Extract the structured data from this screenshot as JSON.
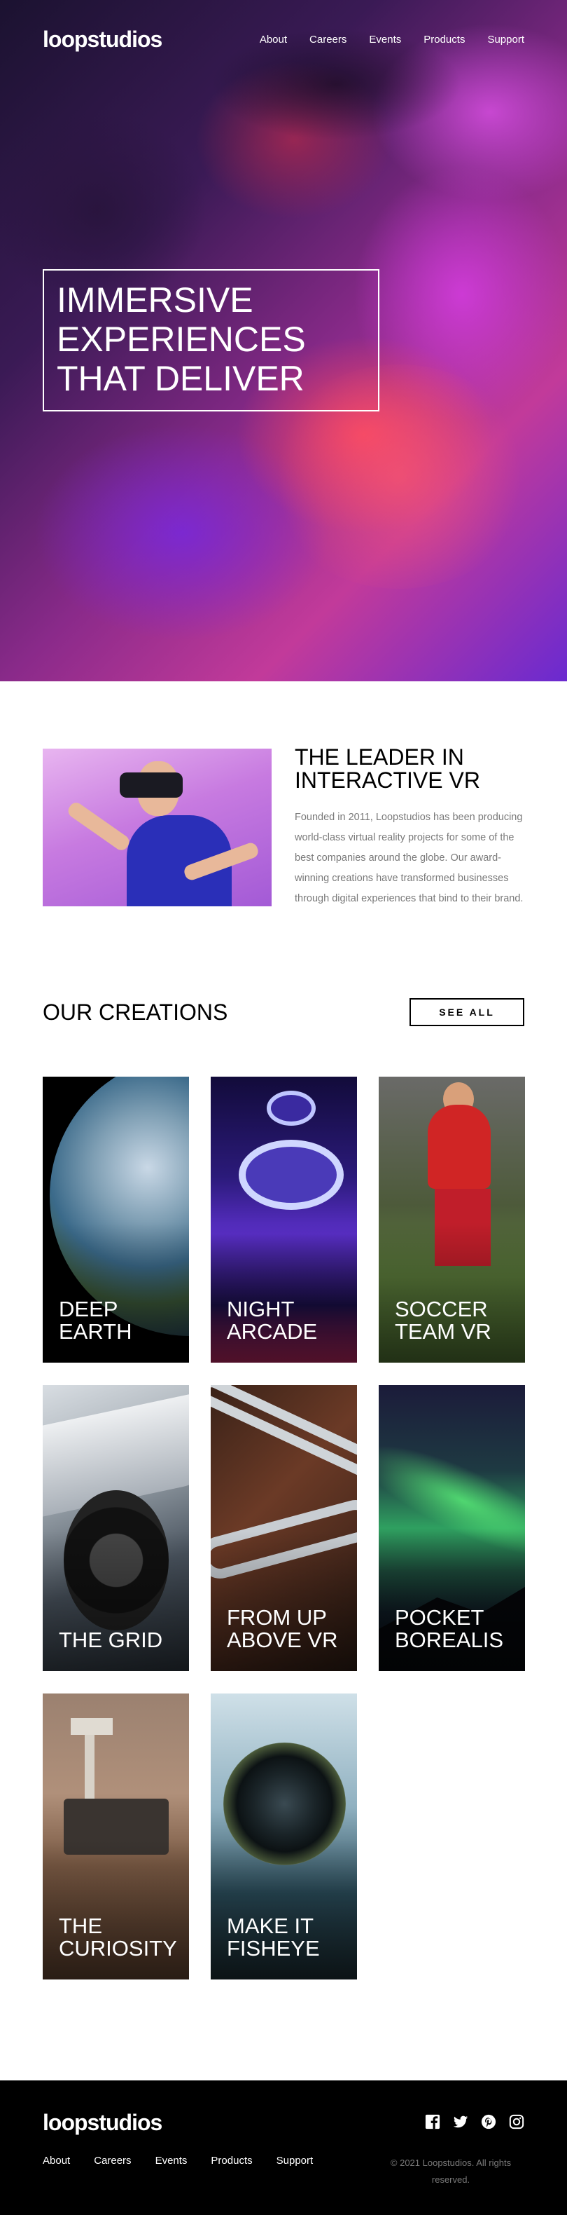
{
  "nav": {
    "logo": "loopstudios",
    "links": [
      "About",
      "Careers",
      "Events",
      "Products",
      "Support"
    ]
  },
  "hero": {
    "title": "Immersive experiences that deliver"
  },
  "leader": {
    "title": "The leader in interactive VR",
    "body": "Founded in 2011, Loopstudios has been producing world-class virtual reality projects for some of the best companies around the globe. Our award-winning creations have transformed businesses through digital experiences that bind to their brand."
  },
  "creations": {
    "title": "Our creations",
    "see_all": "See all",
    "items": [
      {
        "label": "Deep earth"
      },
      {
        "label": "Night arcade"
      },
      {
        "label": "Soccer team VR"
      },
      {
        "label": "The grid"
      },
      {
        "label": "From up above VR"
      },
      {
        "label": "Pocket borealis"
      },
      {
        "label": "The curiosity"
      },
      {
        "label": "Make it fisheye"
      }
    ]
  },
  "footer": {
    "logo": "loopstudios",
    "links": [
      "About",
      "Careers",
      "Events",
      "Products",
      "Support"
    ],
    "socials": [
      "facebook-icon",
      "twitter-icon",
      "pinterest-icon",
      "instagram-icon"
    ],
    "copyright": "© 2021 Loopstudios. All rights reserved."
  }
}
